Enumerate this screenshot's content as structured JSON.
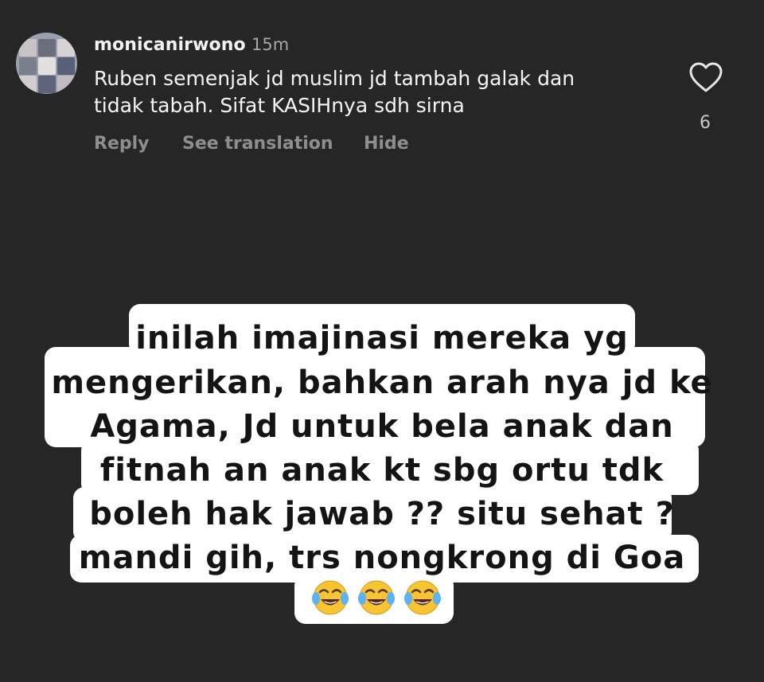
{
  "comment": {
    "username": "monicanirwono",
    "time": "15m",
    "text_lines": [
      "Ruben semenjak jd muslim jd tambah galak dan",
      "tidak tabah. Sifat KASIHnya sdh sirna"
    ],
    "actions": {
      "reply": "Reply",
      "see_translation": "See translation",
      "hide": "Hide"
    },
    "like_count": "6",
    "icons": {
      "like": "heart-outline-icon",
      "avatar": "avatar"
    }
  },
  "sticker": {
    "lines": [
      "inilah imajinasi mereka yg",
      "mengerikan, bahkan arah nya jd ke",
      "Agama, Jd untuk bela anak dan",
      "fitnah an anak kt sbg ortu tdk",
      "boleh hak jawab ?? situ sehat ?",
      "mandi gih, trs nongkrong di Goa"
    ],
    "emojis": [
      "face-with-tears-of-joy-emoji",
      "face-with-tears-of-joy-emoji",
      "face-with-tears-of-joy-emoji"
    ],
    "background_color": "#ffffff",
    "text_color": "#141414"
  },
  "colors": {
    "page_background": "#262626",
    "primary_text": "#f5f5f5",
    "secondary_text": "#8e8e8e"
  }
}
